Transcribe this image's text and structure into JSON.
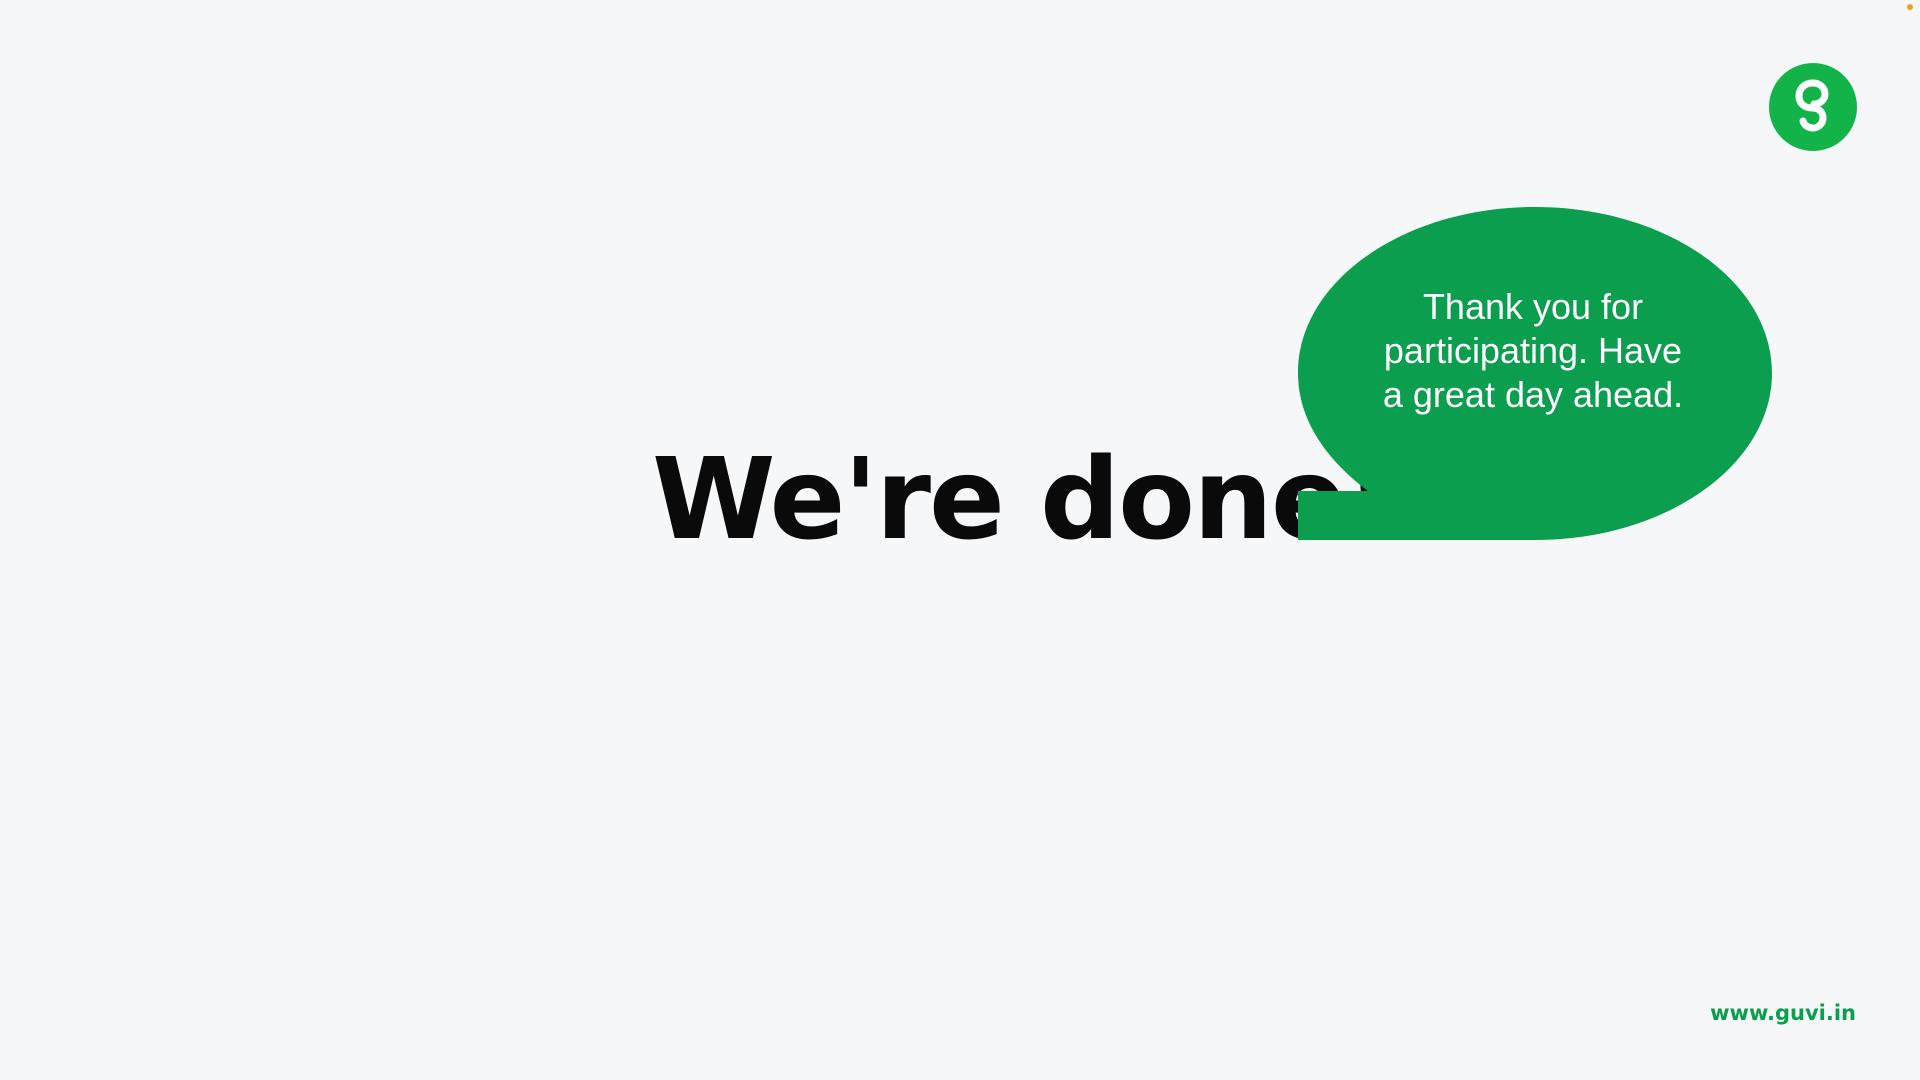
{
  "slide": {
    "headline": "We're done!",
    "bubble_text": "Thank you for participating. Have a great day ahead.",
    "footer_url": "www.guvi.in"
  },
  "brand": {
    "logo_icon": "guvi-logo-icon",
    "accent_color": "#0a9e4e",
    "logo_color": "#12b348",
    "background_color": "#f5f7f9",
    "headline_color": "#0a0a0a"
  }
}
